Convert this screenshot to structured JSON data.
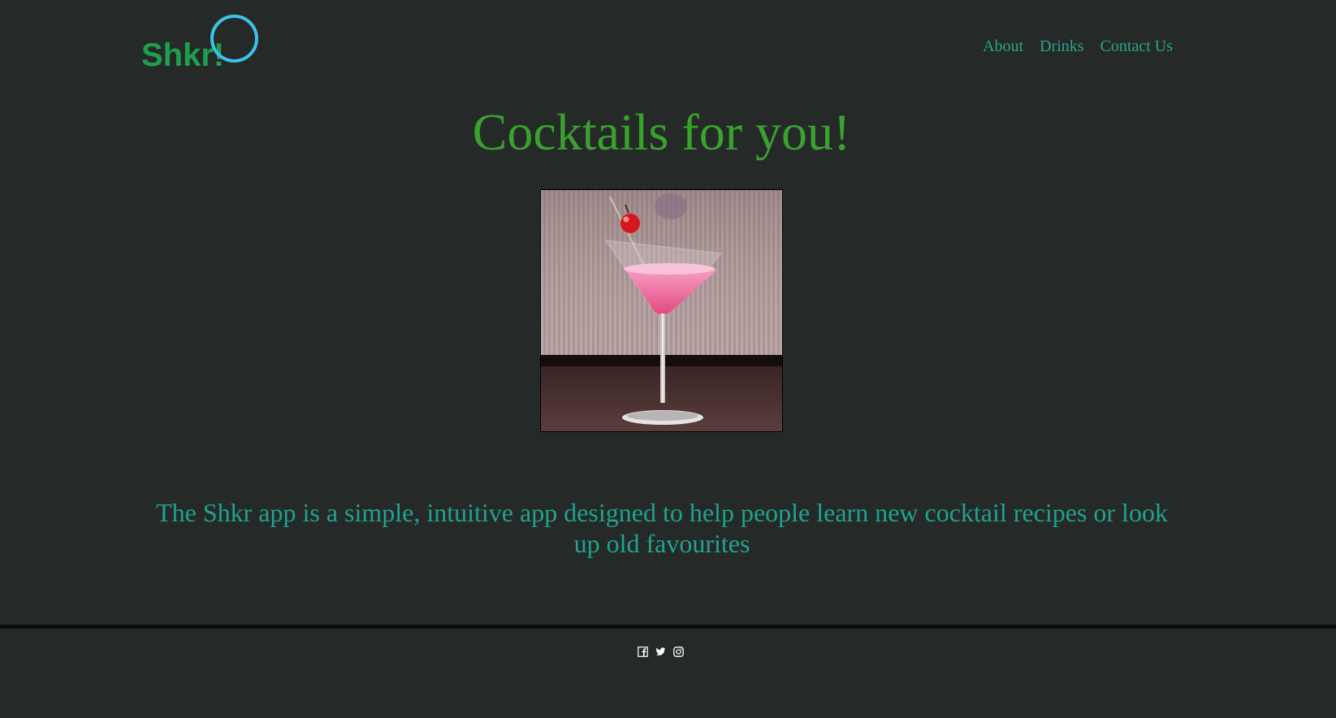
{
  "colors": {
    "background": "#252a28",
    "logo_text": "#1f9e4f",
    "logo_ring": "#3cc3ea",
    "nav_link": "#2ba38d",
    "hero_title": "#3aa12f",
    "tagline": "#1fa38f",
    "footer_icons": "#ffffff"
  },
  "header": {
    "logo_text": "Shkr!",
    "nav": [
      {
        "label": "About"
      },
      {
        "label": "Drinks"
      },
      {
        "label": "Contact Us"
      }
    ]
  },
  "hero": {
    "title": "Cocktails for you!",
    "image_subject": "pink cocktail in martini glass with cherry"
  },
  "main": {
    "tagline": "The Shkr app is a simple, intuitive app designed to help people learn new cocktail recipes or look up old favourites"
  },
  "footer": {
    "social_icons": [
      "facebook-icon",
      "twitter-icon",
      "instagram-icon"
    ]
  }
}
